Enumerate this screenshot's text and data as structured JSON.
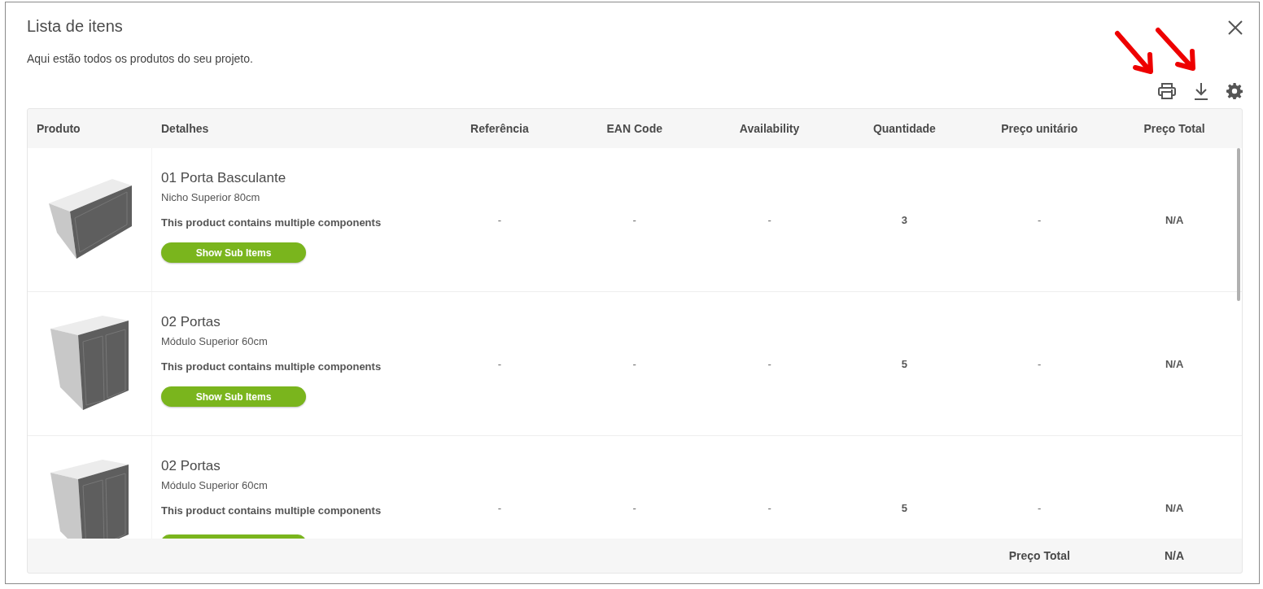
{
  "dialog": {
    "title": "Lista de itens",
    "subtitle": "Aqui estão todos os produtos do seu projeto."
  },
  "table": {
    "columns": [
      "Produto",
      "Detalhes",
      "Referência",
      "EAN Code",
      "Availability",
      "Quantidade",
      "Preço unitário",
      "Preço Total"
    ],
    "rows": [
      {
        "kind": "wide",
        "name": "01 Porta Basculante",
        "description": "Nicho Superior 80cm",
        "note": "This product contains multiple components",
        "button": "Show Sub Items",
        "reference": "-",
        "ean": "-",
        "availability": "-",
        "quantity": "3",
        "unit_price": "-",
        "total_price": "N/A"
      },
      {
        "kind": "tall",
        "name": "02 Portas",
        "description": "Módulo Superior 60cm",
        "note": "This product contains multiple components",
        "button": "Show Sub Items",
        "reference": "-",
        "ean": "-",
        "availability": "-",
        "quantity": "5",
        "unit_price": "-",
        "total_price": "N/A"
      },
      {
        "kind": "tall",
        "name": "02 Portas",
        "description": "Módulo Superior 60cm",
        "note": "This product contains multiple components",
        "button_cut_off": true,
        "reference": "-",
        "ean": "-",
        "availability": "-",
        "quantity": "5",
        "unit_price": "-",
        "total_price": "N/A"
      }
    ],
    "footer": {
      "label": "Preço Total",
      "value": "N/A"
    }
  }
}
